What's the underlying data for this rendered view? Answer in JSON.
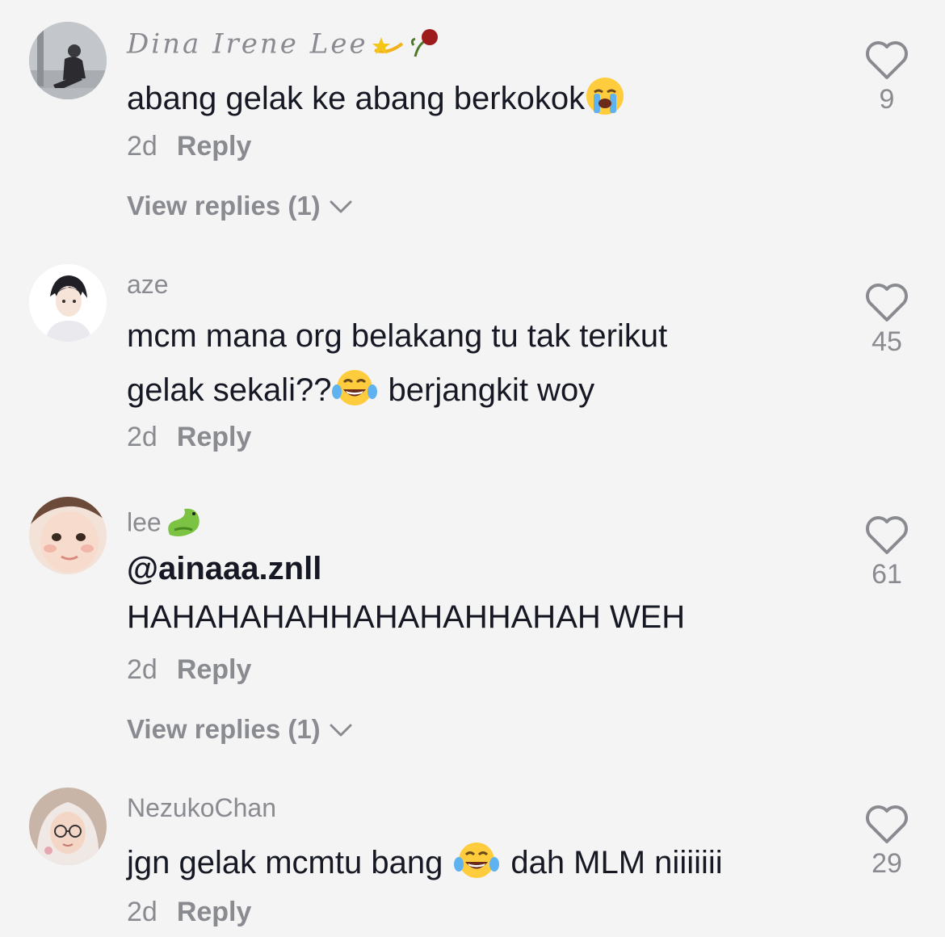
{
  "comments": [
    {
      "username": "Dina Irene Lee",
      "lines": [
        "abang gelak ke abang berkokok"
      ],
      "time": "2d",
      "reply_label": "Reply",
      "view_replies": "View replies (1)",
      "likes": "9"
    },
    {
      "username": "aze",
      "lines": [
        "mcm mana org belakang tu tak terikut",
        "gelak sekali??",
        "berjangkit woy"
      ],
      "time": "2d",
      "reply_label": "Reply",
      "likes": "45"
    },
    {
      "username": "lee",
      "lines": [
        "@ainaaa.znll",
        "HAHAHAHAHHAHAHAHHAHAH WEH"
      ],
      "time": "2d",
      "reply_label": "Reply",
      "view_replies": "View replies (1)",
      "likes": "61"
    },
    {
      "username": "NezukoChan",
      "lines": [
        "jgn gelak mcmtu bang",
        "dah MLM niiiiiii"
      ],
      "time": "2d",
      "reply_label": "Reply",
      "likes": "29"
    }
  ],
  "icons": {
    "like": "heart-outline-icon",
    "expand": "chevron-down-icon",
    "emoji_crying": "loudly-crying-face-icon",
    "emoji_laughing": "tears-of-joy-icon"
  },
  "colors": {
    "background": "#f4f4f4",
    "text": "#161823",
    "muted": "#8a8b91"
  }
}
